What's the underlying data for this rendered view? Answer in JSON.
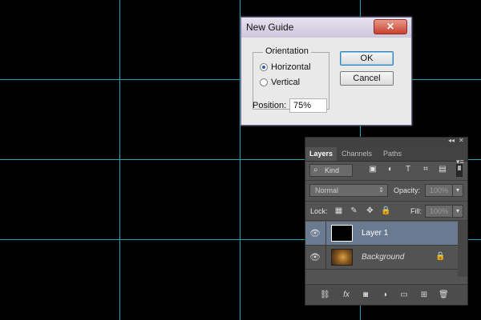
{
  "dialog": {
    "title": "New Guide",
    "close_label": "✕",
    "orientation_label": "Orientation",
    "options": [
      {
        "label": "Horizontal",
        "selected": true
      },
      {
        "label": "Vertical",
        "selected": false
      }
    ],
    "position_label": "Position:",
    "position_value": "75%",
    "ok_label": "OK",
    "cancel_label": "Cancel"
  },
  "layers_panel": {
    "collapse_glyph": "◂◂",
    "close_glyph": "✕",
    "menu_glyph": "▾≡",
    "tabs": [
      "Layers",
      "Channels",
      "Paths"
    ],
    "filter": {
      "kind_label": "Kind",
      "icons": [
        "image-filter-icon",
        "adjustment-filter-icon",
        "type-filter-icon",
        "shape-filter-icon",
        "smart-object-filter-icon"
      ],
      "icon_glyphs": [
        "▣",
        "◐",
        "T",
        "⌗",
        "▤"
      ]
    },
    "blend_mode": "Normal",
    "opacity_label": "Opacity:",
    "opacity_value": "100%",
    "lock_label": "Lock:",
    "lock_icons": [
      "lock-transparent-icon",
      "lock-paint-icon",
      "lock-position-icon",
      "lock-all-icon"
    ],
    "lock_glyphs": [
      "▦",
      "✎",
      "✥",
      "🔒"
    ],
    "fill_label": "Fill:",
    "fill_value": "100%",
    "layers": [
      {
        "name": "Layer 1",
        "selected": true,
        "locked": false
      },
      {
        "name": "Background",
        "selected": false,
        "locked": true
      }
    ],
    "bottom_icons": [
      "link-layers-icon",
      "fx-icon",
      "add-mask-icon",
      "new-adjustment-icon",
      "new-group-icon",
      "new-layer-icon",
      "delete-layer-icon"
    ],
    "bottom_glyphs": [
      "⛓",
      "fx",
      "◙",
      "◑",
      "▭",
      "⊞",
      "🗑"
    ]
  },
  "colors": {
    "guide": "#1fa8b8",
    "canvas": "#000000",
    "panel_bg": "#535353",
    "selected_layer": "#697a91"
  }
}
